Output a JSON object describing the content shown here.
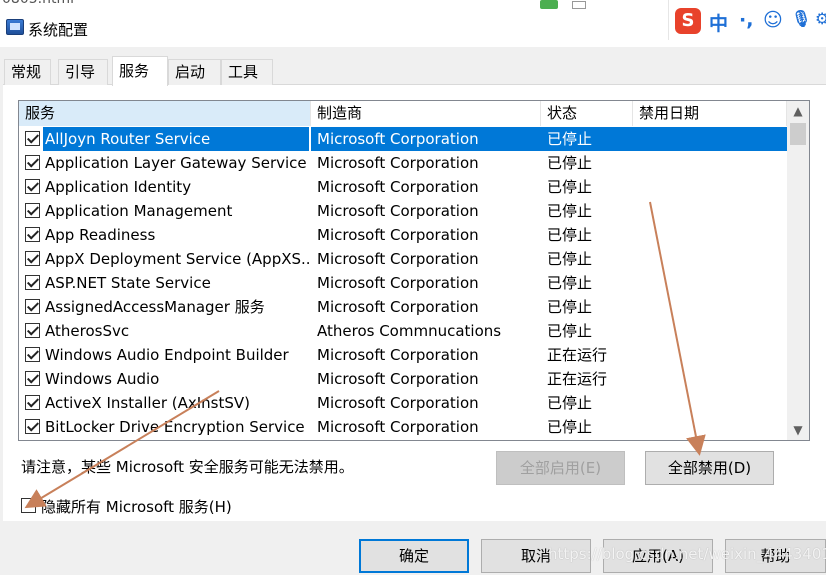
{
  "window": {
    "title": "系统配置"
  },
  "ime": {
    "logo": "S",
    "items": [
      "中",
      "·,",
      "☺",
      "🎙",
      "⚙"
    ]
  },
  "tabs": [
    {
      "label": "常规"
    },
    {
      "label": "引导"
    },
    {
      "label": "服务"
    },
    {
      "label": "启动"
    },
    {
      "label": "工具"
    }
  ],
  "active_tab": "服务",
  "services": {
    "columns": [
      "服务",
      "制造商",
      "状态",
      "禁用日期"
    ],
    "rows": [
      {
        "name": "AllJoyn Router Service",
        "manufacturer": "Microsoft Corporation",
        "status": "已停止",
        "checked": true,
        "selected": true
      },
      {
        "name": "Application Layer Gateway Service",
        "manufacturer": "Microsoft Corporation",
        "status": "已停止",
        "checked": true
      },
      {
        "name": "Application Identity",
        "manufacturer": "Microsoft Corporation",
        "status": "已停止",
        "checked": true
      },
      {
        "name": "Application Management",
        "manufacturer": "Microsoft Corporation",
        "status": "已停止",
        "checked": true
      },
      {
        "name": "App Readiness",
        "manufacturer": "Microsoft Corporation",
        "status": "已停止",
        "checked": true
      },
      {
        "name": "AppX Deployment Service (AppXS...",
        "manufacturer": "Microsoft Corporation",
        "status": "已停止",
        "checked": true
      },
      {
        "name": "ASP.NET State Service",
        "manufacturer": "Microsoft Corporation",
        "status": "已停止",
        "checked": true
      },
      {
        "name": "AssignedAccessManager 服务",
        "manufacturer": "Microsoft Corporation",
        "status": "已停止",
        "checked": true
      },
      {
        "name": "AtherosSvc",
        "manufacturer": "Atheros Commnucations",
        "status": "已停止",
        "checked": true
      },
      {
        "name": "Windows Audio Endpoint Builder",
        "manufacturer": "Microsoft Corporation",
        "status": "正在运行",
        "checked": true
      },
      {
        "name": "Windows Audio",
        "manufacturer": "Microsoft Corporation",
        "status": "正在运行",
        "checked": true
      },
      {
        "name": "ActiveX Installer (AxInstSV)",
        "manufacturer": "Microsoft Corporation",
        "status": "已停止",
        "checked": true
      },
      {
        "name": "BitLocker Drive Encryption Service",
        "manufacturer": "Microsoft Corporation",
        "status": "已停止",
        "checked": true
      }
    ]
  },
  "note": "请注意，某些 Microsoft 安全服务可能无法禁用。",
  "buttons": {
    "enable_all": "全部启用(E)",
    "disable_all": "全部禁用(D)",
    "ok": "确定",
    "cancel": "取消",
    "apply": "应用(A)",
    "help": "帮助"
  },
  "hide_ms_label": "隐藏所有 Microsoft 服务(H)",
  "watermark": "https://blog.csdn.net/weixin_44434017",
  "colors": {
    "selection": "#0078d7",
    "annotation_arrow": "#c8805a"
  }
}
